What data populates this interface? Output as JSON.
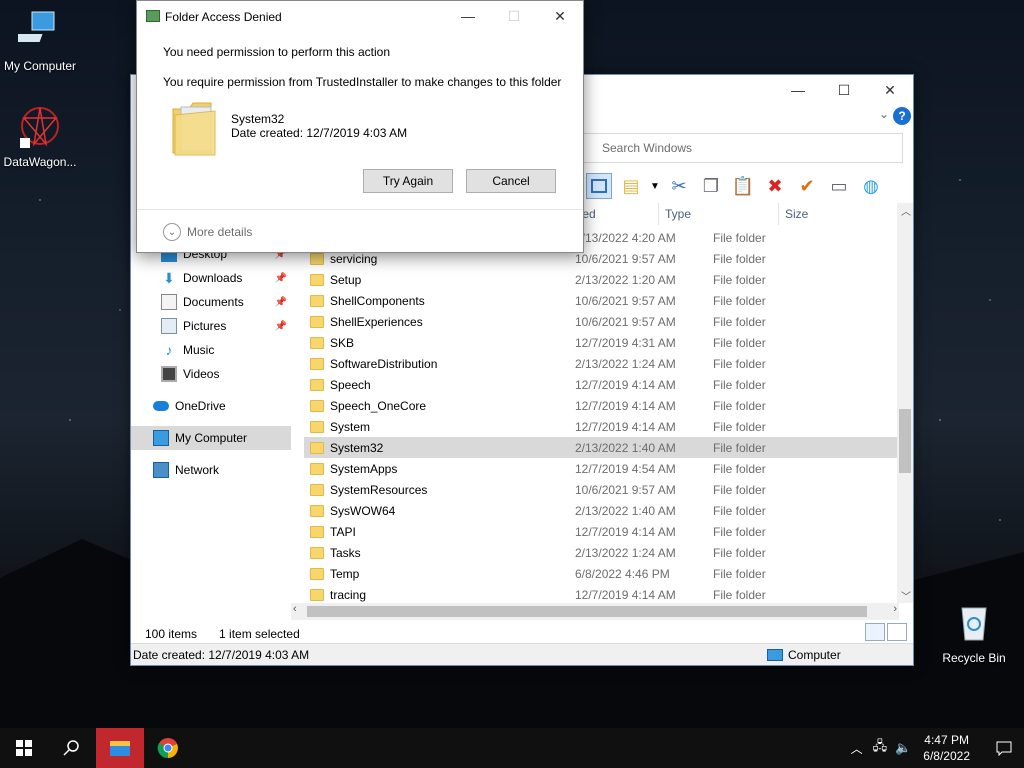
{
  "desktop": {
    "icons": [
      {
        "label": "My Computer",
        "icon": "computer-icon"
      },
      {
        "label": "DataWagon...",
        "icon": "datawagon-icon"
      },
      {
        "label": "Recycle Bin",
        "icon": "recycle-bin-icon"
      }
    ]
  },
  "dialog": {
    "title": "Folder Access Denied",
    "line1": "You need permission to perform this action",
    "line2": "You require permission from TrustedInstaller to make changes to this folder",
    "item_name": "System32",
    "item_date": "Date created: 12/7/2019 4:03 AM",
    "try_again": "Try Again",
    "cancel": "Cancel",
    "more_details": "More details"
  },
  "explorer": {
    "search_placeholder": "Search Windows",
    "columns": {
      "date": "te modified",
      "type": "Type",
      "size": "Size"
    },
    "nav": [
      {
        "label": "Desktop",
        "icon": "desktop-icon",
        "pinned": true
      },
      {
        "label": "Downloads",
        "icon": "download-icon",
        "pinned": true
      },
      {
        "label": "Documents",
        "icon": "document-icon",
        "pinned": true
      },
      {
        "label": "Pictures",
        "icon": "picture-icon",
        "pinned": true
      },
      {
        "label": "Music",
        "icon": "music-icon",
        "pinned": false
      },
      {
        "label": "Videos",
        "icon": "video-icon",
        "pinned": false
      },
      {
        "label": "OneDrive",
        "icon": "cloud-icon",
        "pinned": false
      },
      {
        "label": "My Computer",
        "icon": "computer-icon",
        "pinned": false,
        "selected": true
      },
      {
        "label": "Network",
        "icon": "network-icon",
        "pinned": false
      }
    ],
    "files": [
      {
        "name": "",
        "date": "2/13/2022 4:20 AM",
        "type": "File folder"
      },
      {
        "name": "servicing",
        "date": "10/6/2021 9:57 AM",
        "type": "File folder"
      },
      {
        "name": "Setup",
        "date": "2/13/2022 1:20 AM",
        "type": "File folder"
      },
      {
        "name": "ShellComponents",
        "date": "10/6/2021 9:57 AM",
        "type": "File folder"
      },
      {
        "name": "ShellExperiences",
        "date": "10/6/2021 9:57 AM",
        "type": "File folder"
      },
      {
        "name": "SKB",
        "date": "12/7/2019 4:31 AM",
        "type": "File folder"
      },
      {
        "name": "SoftwareDistribution",
        "date": "2/13/2022 1:24 AM",
        "type": "File folder"
      },
      {
        "name": "Speech",
        "date": "12/7/2019 4:14 AM",
        "type": "File folder"
      },
      {
        "name": "Speech_OneCore",
        "date": "12/7/2019 4:14 AM",
        "type": "File folder"
      },
      {
        "name": "System",
        "date": "12/7/2019 4:14 AM",
        "type": "File folder"
      },
      {
        "name": "System32",
        "date": "2/13/2022 1:40 AM",
        "type": "File folder",
        "selected": true
      },
      {
        "name": "SystemApps",
        "date": "12/7/2019 4:54 AM",
        "type": "File folder"
      },
      {
        "name": "SystemResources",
        "date": "10/6/2021 9:57 AM",
        "type": "File folder"
      },
      {
        "name": "SysWOW64",
        "date": "2/13/2022 1:40 AM",
        "type": "File folder"
      },
      {
        "name": "TAPI",
        "date": "12/7/2019 4:14 AM",
        "type": "File folder"
      },
      {
        "name": "Tasks",
        "date": "2/13/2022 1:24 AM",
        "type": "File folder"
      },
      {
        "name": "Temp",
        "date": "6/8/2022 4:46 PM",
        "type": "File folder"
      },
      {
        "name": "tracing",
        "date": "12/7/2019 4:14 AM",
        "type": "File folder"
      }
    ],
    "status": {
      "count": "100 items",
      "selected": "1 item selected"
    },
    "details": {
      "date_created": "Date created: 12/7/2019 4:03 AM",
      "location": "Computer"
    }
  },
  "taskbar": {
    "time": "4:47 PM",
    "date": "6/8/2022"
  },
  "colors": {
    "taskbar_active": "#c1272d",
    "selection": "#d9d9d9",
    "accent": "#0078d7"
  }
}
